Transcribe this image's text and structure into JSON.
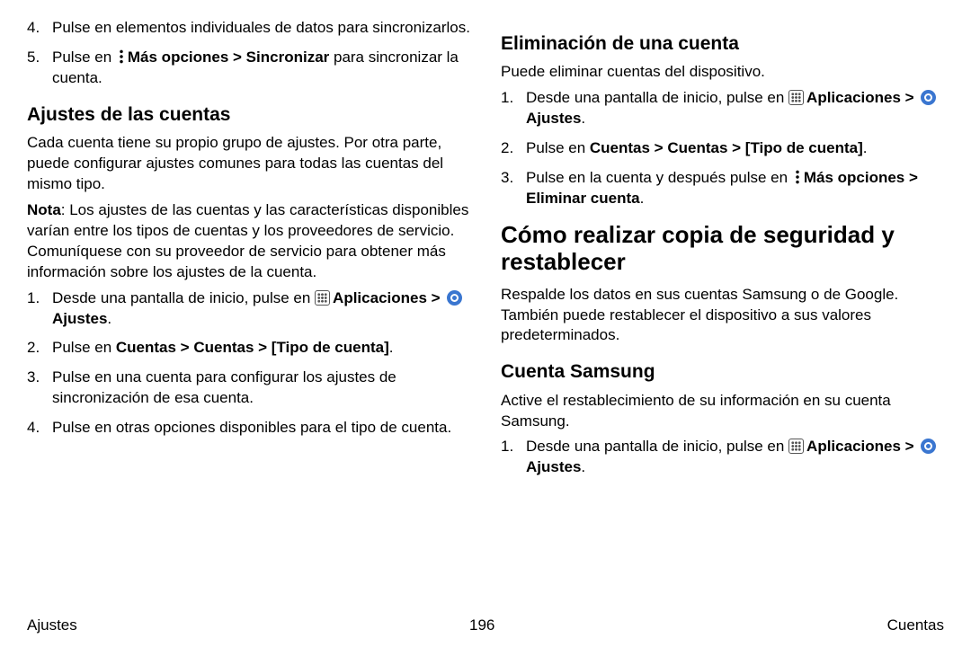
{
  "left": {
    "topList": {
      "start": 4,
      "items": [
        {
          "num": "4.",
          "body": [
            "Pulse en elementos individuales de datos para sincronizarlos."
          ]
        },
        {
          "num": "5.",
          "body": [
            "Pulse en ",
            {
              "icon": "more"
            },
            {
              "b": "Más opciones > Sincronizar"
            },
            " para sincronizar la cuenta."
          ]
        }
      ]
    },
    "h2a": "Ajustes de las cuentas",
    "p1": "Cada cuenta tiene su propio grupo de ajustes. Por otra parte, puede configurar ajustes comunes para todas las cuentas del mismo tipo.",
    "p2": [
      {
        "b": "Nota"
      },
      ": Los ajustes de las cuentas y las características disponibles varían entre los tipos de cuentas y los proveedores de servicio. Comuníquese con su proveedor de servicio para obtener más información sobre los ajustes de la cuenta."
    ],
    "list2": [
      {
        "num": "1.",
        "body": [
          "Desde una pantalla de inicio, pulse en ",
          {
            "icon": "apps"
          },
          {
            "b": "Aplicaciones > "
          },
          {
            "icon": "gear"
          },
          {
            "b": "Ajustes"
          },
          "."
        ]
      },
      {
        "num": "2.",
        "body": [
          "Pulse en ",
          {
            "b": "Cuentas > Cuentas > [Tipo de cuenta]"
          },
          "."
        ]
      },
      {
        "num": "3.",
        "body": [
          "Pulse en una cuenta para configurar los ajustes de sincronización de esa cuenta."
        ]
      },
      {
        "num": "4.",
        "body": [
          "Pulse en otras opciones disponibles para el tipo de cuenta."
        ]
      }
    ]
  },
  "right": {
    "h2a": "Eliminación de una cuenta",
    "p1": "Puede eliminar cuentas del dispositivo.",
    "list1": [
      {
        "num": "1.",
        "body": [
          "Desde una pantalla de inicio, pulse en ",
          {
            "icon": "apps"
          },
          {
            "b": "Aplicaciones > "
          },
          {
            "icon": "gear"
          },
          {
            "b": "Ajustes"
          },
          "."
        ]
      },
      {
        "num": "2.",
        "body": [
          "Pulse en ",
          {
            "b": "Cuentas > Cuentas > [Tipo de cuenta]"
          },
          "."
        ]
      },
      {
        "num": "3.",
        "body": [
          "Pulse en la cuenta y después pulse en ",
          {
            "icon": "more"
          },
          {
            "b": "Más opciones > Eliminar cuenta"
          },
          "."
        ]
      }
    ],
    "h1": "Cómo realizar copia de seguridad y restablecer",
    "p2": "Respalde los datos en sus cuentas Samsung o de Google. También puede restablecer el dispositivo a sus valores predeterminados.",
    "h2b": "Cuenta Samsung",
    "p3": "Active el restablecimiento de su información en su cuenta Samsung.",
    "list2": [
      {
        "num": "1.",
        "body": [
          "Desde una pantalla de inicio, pulse en ",
          {
            "icon": "apps"
          },
          {
            "b": "Aplicaciones > "
          },
          {
            "icon": "gear"
          },
          {
            "b": "Ajustes"
          },
          "."
        ]
      }
    ]
  },
  "footer": {
    "left": "Ajustes",
    "center": "196",
    "right": "Cuentas"
  }
}
